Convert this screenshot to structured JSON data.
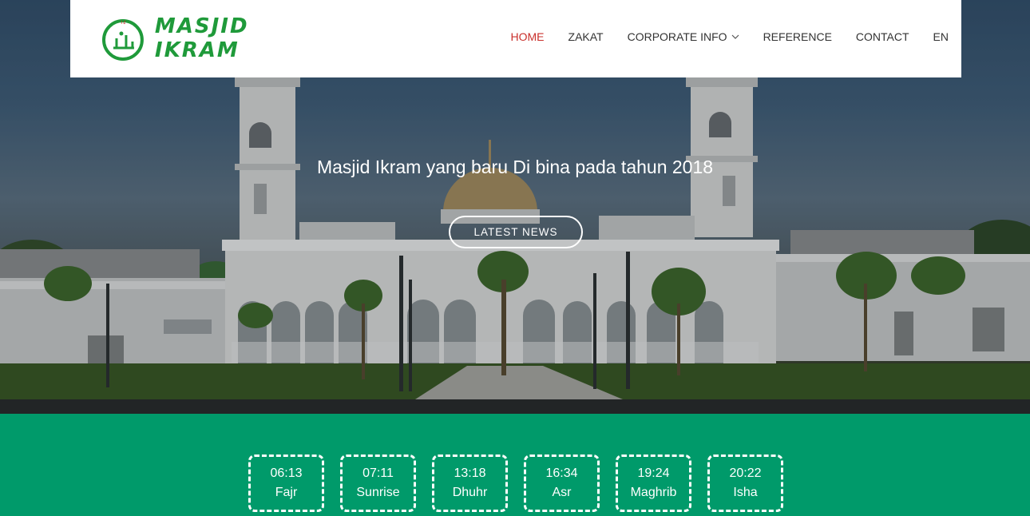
{
  "brand": {
    "name": "MASJID IKRAM"
  },
  "nav": {
    "items": [
      {
        "label": "HOME",
        "active": true
      },
      {
        "label": "ZAKAT"
      },
      {
        "label": "CORPORATE INFO",
        "dropdown": true
      },
      {
        "label": "REFERENCE"
      },
      {
        "label": "CONTACT"
      },
      {
        "label": "EN"
      }
    ]
  },
  "hero": {
    "title": "Masjid Ikram yang baru Di bina pada tahun 2018",
    "button": "LATEST NEWS"
  },
  "prayers": [
    {
      "time": "06:13",
      "name": "Fajr"
    },
    {
      "time": "07:11",
      "name": "Sunrise"
    },
    {
      "time": "13:18",
      "name": "Dhuhr"
    },
    {
      "time": "16:34",
      "name": "Asr"
    },
    {
      "time": "19:24",
      "name": "Maghrib"
    },
    {
      "time": "20:22",
      "name": "Isha"
    }
  ],
  "colors": {
    "brand_green": "#1f9a3a",
    "band_green": "#009a6a",
    "active_nav": "#c9302c"
  }
}
